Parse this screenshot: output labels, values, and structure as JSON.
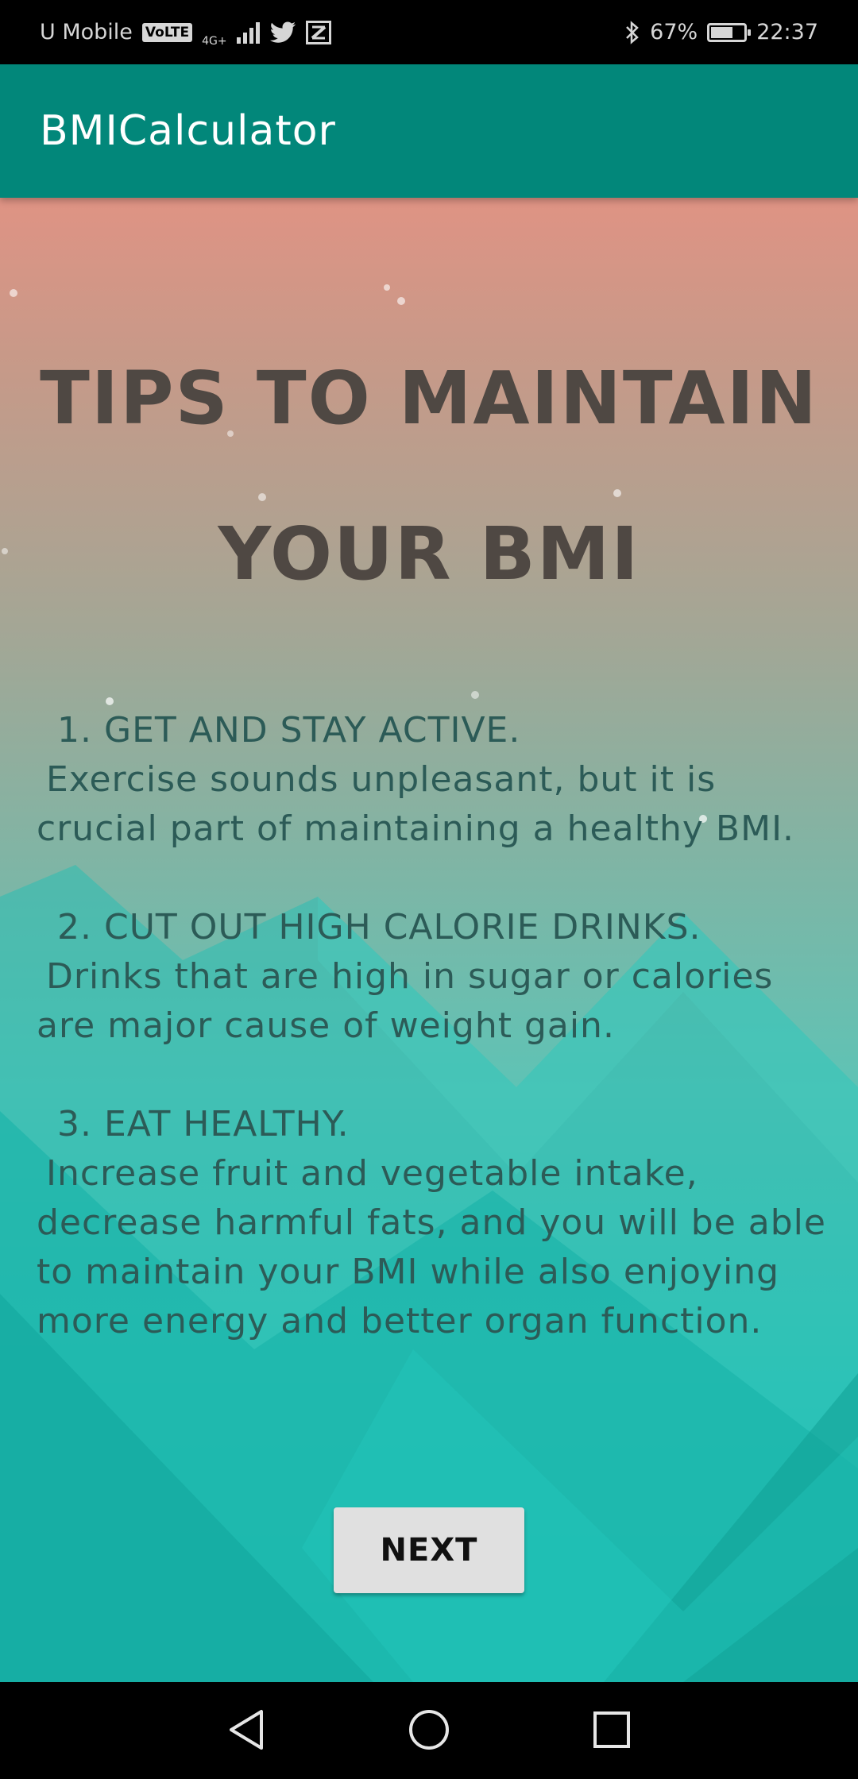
{
  "status_bar": {
    "carrier": "U Mobile",
    "volte_label": "VoLTE",
    "network_label": "4G+",
    "battery_percent": "67%",
    "battery_level": 0.67,
    "time": "22:37"
  },
  "app_bar": {
    "title": "BMICalculator",
    "background_color": "#02877a"
  },
  "tips": {
    "title_line1": "TIPS TO MAINTAIN",
    "title_line2": "YOUR BMI",
    "items": [
      {
        "heading": "1. GET AND STAY ACTIVE.",
        "text": "Exercise sounds unpleasant, but it is crucial part of maintaining a healthy BMI."
      },
      {
        "heading": "2. CUT OUT HIGH CALORIE DRINKS.",
        "text": "Drinks that are high in sugar or calories are major cause of weight gain."
      },
      {
        "heading": "3. EAT HEALTHY.",
        "text": "Increase fruit and vegetable intake, decrease harmful fats, and you will be able to maintain your BMI while also enjoying more energy and better organ function."
      }
    ]
  },
  "actions": {
    "next_label": "NEXT"
  },
  "nav_bar": {
    "back_icon": "back-triangle-icon",
    "home_icon": "home-circle-icon",
    "recents_icon": "recents-square-icon"
  }
}
